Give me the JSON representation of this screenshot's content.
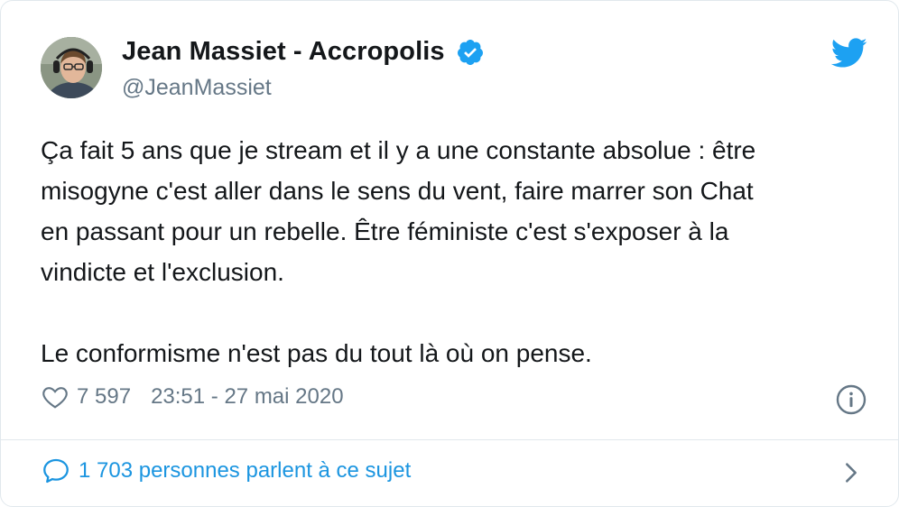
{
  "tweet": {
    "display_name": "Jean Massiet - Accropolis",
    "handle": "@JeanMassiet",
    "text": "Ça fait 5 ans que je stream et il y a une constante absolue : être\nmisogyne c'est aller dans le sens du vent, faire marrer son Chat\nen passant pour un rebelle. Être féministe c'est s'exposer à la\nvindicte et l'exclusion.\n\nLe conformisme n'est pas du tout là où on pense.",
    "likes": "7 597",
    "timestamp": "23:51 - 27 mai 2020",
    "discussion": "1 703 personnes parlent à ce sujet"
  },
  "icons": {
    "verified": "verified-badge-icon",
    "brand": "twitter-bird-icon",
    "like": "heart-icon",
    "info": "info-icon",
    "reply": "speech-bubble-icon",
    "chevron": "chevron-right-icon"
  },
  "colors": {
    "accent": "#1DA1F2",
    "link": "#1B95E0",
    "secondary_text": "#657786",
    "border": "#E1E8ED",
    "primary_text": "#14171A"
  }
}
